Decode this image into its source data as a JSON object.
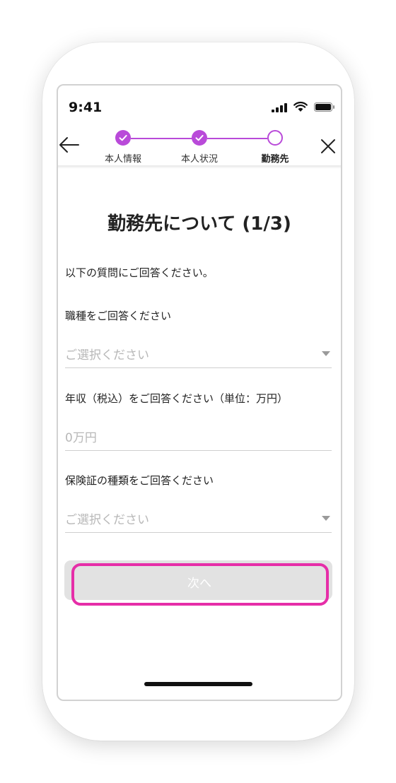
{
  "status_bar": {
    "time": "9:41"
  },
  "progress": {
    "steps": [
      {
        "label": "本人情報",
        "state": "done"
      },
      {
        "label": "本人状況",
        "state": "done"
      },
      {
        "label": "勤務先",
        "state": "current"
      }
    ],
    "accent_color": "#b94ad9"
  },
  "page": {
    "title": "勤務先について (1/3)",
    "intro": "以下の質問にご回答ください。"
  },
  "form": {
    "occupation": {
      "label": "職種をご回答ください",
      "placeholder": "ご選択ください"
    },
    "income": {
      "label": "年収（税込）をご回答ください（単位：万円）",
      "placeholder": "0万円"
    },
    "insurance": {
      "label": "保険証の種類をご回答ください",
      "placeholder": "ご選択ください"
    }
  },
  "next_button": {
    "label": "次へ",
    "highlight_color": "#e62ea8"
  }
}
